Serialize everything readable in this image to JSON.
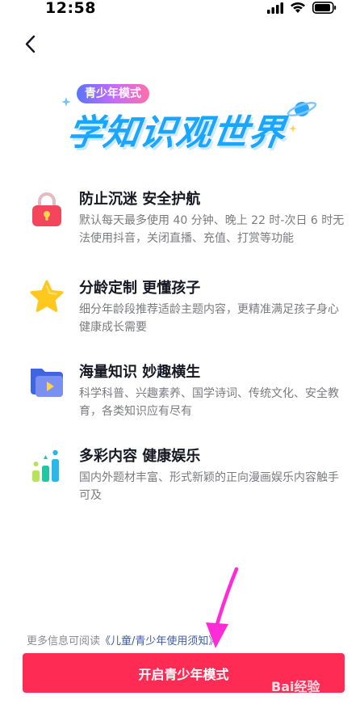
{
  "status_bar": {
    "time": "12:58"
  },
  "hero": {
    "badge": "青少年模式",
    "title": "学知识观世界"
  },
  "features": [
    {
      "title": "防止沉迷 安全护航",
      "description": "默认每天最多使用 40 分钟、晚上 22 时-次日 6 时无法使用抖音，关闭直播、充值、打赏等功能",
      "icon": "lock-icon"
    },
    {
      "title": "分龄定制 更懂孩子",
      "description": "细分年龄段推荐适龄主题内容，更精准满足孩子身心健康成长需要",
      "icon": "star-icon"
    },
    {
      "title": "海量知识 妙趣横生",
      "description": "科学科普、兴趣素养、国学诗词、传统文化、安全教育，各类知识应有尽有",
      "icon": "video-folder-icon"
    },
    {
      "title": "多彩内容 健康娱乐",
      "description": "国内外题材丰富、形式新颖的正向漫画娱乐内容触手可及",
      "icon": "bar-chart-icon"
    }
  ],
  "footer": {
    "note_prefix": "更多信息可阅读",
    "link_text": "《儿童/青少年使用须知》"
  },
  "primary_button": {
    "label": "开启青少年模式"
  },
  "watermark": "Bai经验",
  "colors": {
    "accent": "#fe2c55",
    "hero_blue": "#1aa6ff",
    "link": "#3c5aa6",
    "annotation": "#ff2bd6"
  }
}
